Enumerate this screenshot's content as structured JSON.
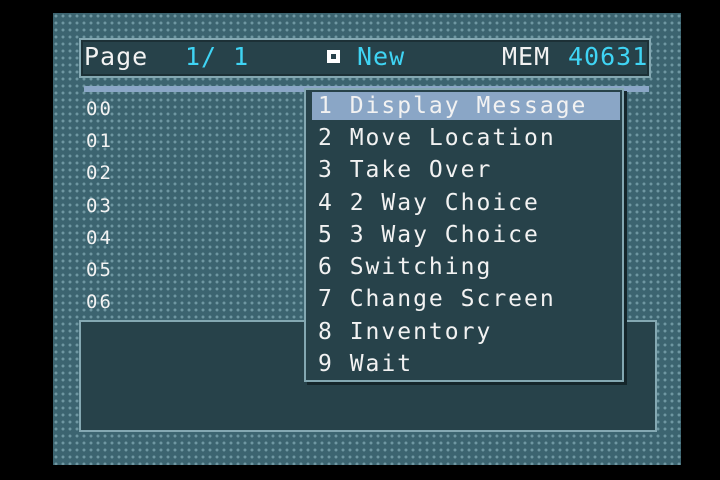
{
  "header": {
    "page_label": "Page",
    "page_value": "1/ 1",
    "new_label": "New",
    "mem_label": "MEM",
    "mem_value": "40631"
  },
  "slots": [
    "00",
    "01",
    "02",
    "03",
    "04",
    "05",
    "06"
  ],
  "menu": {
    "items": [
      {
        "label": "1 Display Message",
        "selected": true
      },
      {
        "label": "2 Move Location",
        "selected": false
      },
      {
        "label": "3 Take Over",
        "selected": false
      },
      {
        "label": "4 2 Way Choice",
        "selected": false
      },
      {
        "label": "5 3 Way Choice",
        "selected": false
      },
      {
        "label": "6 Switching",
        "selected": false
      },
      {
        "label": "7 Change Screen",
        "selected": false
      },
      {
        "label": "8 Inventory",
        "selected": false
      },
      {
        "label": "9 Wait",
        "selected": false
      }
    ]
  },
  "colors": {
    "background": "#3c6470",
    "panel": "#27424a",
    "highlight": "#8aa6c6",
    "accent_text": "#3fd4f4",
    "text": "#f2f2f2"
  }
}
